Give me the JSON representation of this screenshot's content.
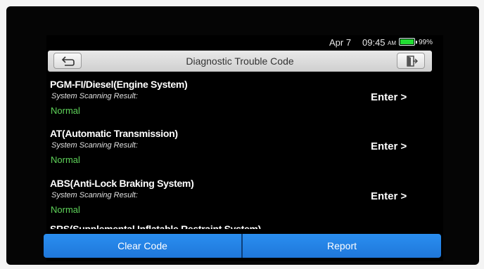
{
  "status": {
    "date": "Apr 7",
    "time": "09:45",
    "ampm": "AM",
    "battery_percent_label": "99%",
    "battery_level": 0.99,
    "battery_color": "#22dd33"
  },
  "header": {
    "title": "Diagnostic Trouble Code",
    "back_icon": "back-arrow-icon",
    "exit_icon": "exit-door-icon"
  },
  "systems": [
    {
      "name": "PGM-FI/Diesel(Engine System)",
      "label": "System Scanning Result:",
      "result": "Normal",
      "action": "Enter >"
    },
    {
      "name": "AT(Automatic Transmission)",
      "label": "System Scanning Result:",
      "result": "Normal",
      "action": "Enter >"
    },
    {
      "name": "ABS(Anti-Lock Braking System)",
      "label": "System Scanning Result:",
      "result": "Normal",
      "action": "Enter >"
    },
    {
      "name": "SRS(Supplemental Inflatable Restraint System)"
    }
  ],
  "footer": {
    "clear_label": "Clear Code",
    "report_label": "Report"
  },
  "colors": {
    "normal": "#5fd35a",
    "button": "#1f77da"
  }
}
